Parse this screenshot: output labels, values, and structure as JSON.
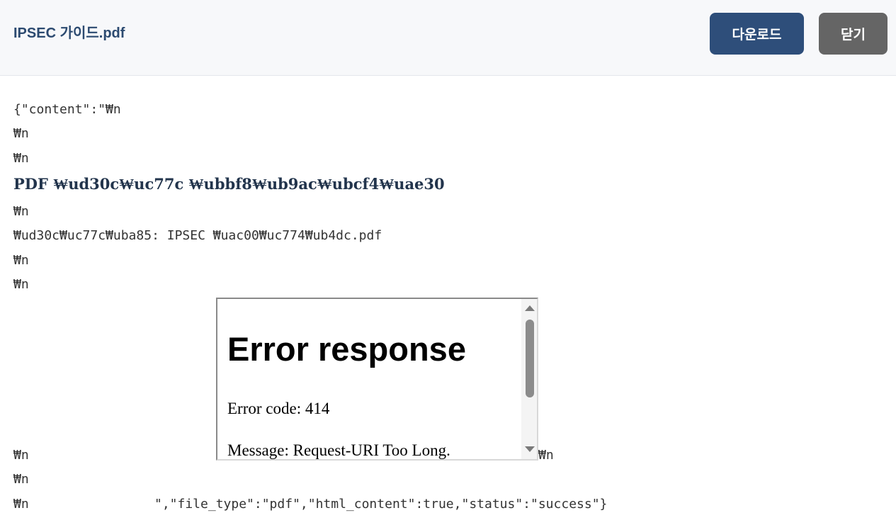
{
  "header": {
    "title": "IPSEC 가이드.pdf",
    "download_label": "다운로드",
    "close_label": "닫기"
  },
  "content": {
    "lines": [
      "{\"content\":\"₩n",
      "₩n",
      "₩n",
      "PDF ₩ud30c₩uc77c ₩ubbf8₩ub9ac₩ubcf4₩uae30",
      "₩n",
      "₩ud30c₩uc77c₩uba85: IPSEC ₩uac00₩uc774₩ub4dc.pdf",
      "₩n",
      "₩n"
    ],
    "after_iframe_left": "₩n",
    "after_iframe_right": "₩n",
    "line_13": "₩n",
    "line_14_left": "₩n",
    "line_14_right": "\",\"file_type\":\"pdf\",\"html_content\":true,\"status\":\"success\"}"
  },
  "iframe": {
    "title": "Error response",
    "code_line": "Error code: 414",
    "message_line": "Message: Request-URI Too Long."
  },
  "colors": {
    "header_bg": "#f7f8fa",
    "title_text": "#2c4a70",
    "download_button": "#2e4e7a",
    "close_button": "#656565"
  }
}
